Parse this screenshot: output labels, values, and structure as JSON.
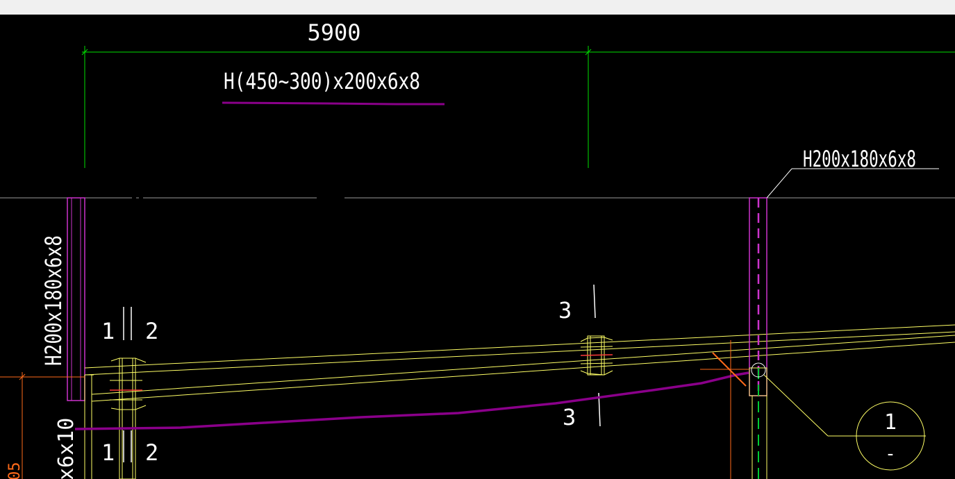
{
  "colors": {
    "background": "#000000",
    "topbar": "#f0f0f0",
    "dimension": "#00e000",
    "beam": "#ffff66",
    "column": "#cc33cc",
    "markup": "#8a008a",
    "text": "#ffffff",
    "grid": "#9a9a9a",
    "leader": "#ffffff",
    "accent": "#ff6a1a",
    "centerline": "#00cc33"
  },
  "dimensions": {
    "span_label": "5900"
  },
  "labels": {
    "rafter_section": "H(450~300)x200x6x8",
    "column_right_section": "H200x180x6x8",
    "column_left_section": "H200x180x6x8",
    "bottom_left_section": "x6x10",
    "bottom_left_dim": "05",
    "detail_marker_top": "1",
    "detail_marker_bottom": "-",
    "section_1_upper": "1",
    "section_2_upper": "2",
    "section_1_lower": "1",
    "section_2_lower": "2",
    "section_3_upper": "3",
    "section_3_lower": "3"
  }
}
